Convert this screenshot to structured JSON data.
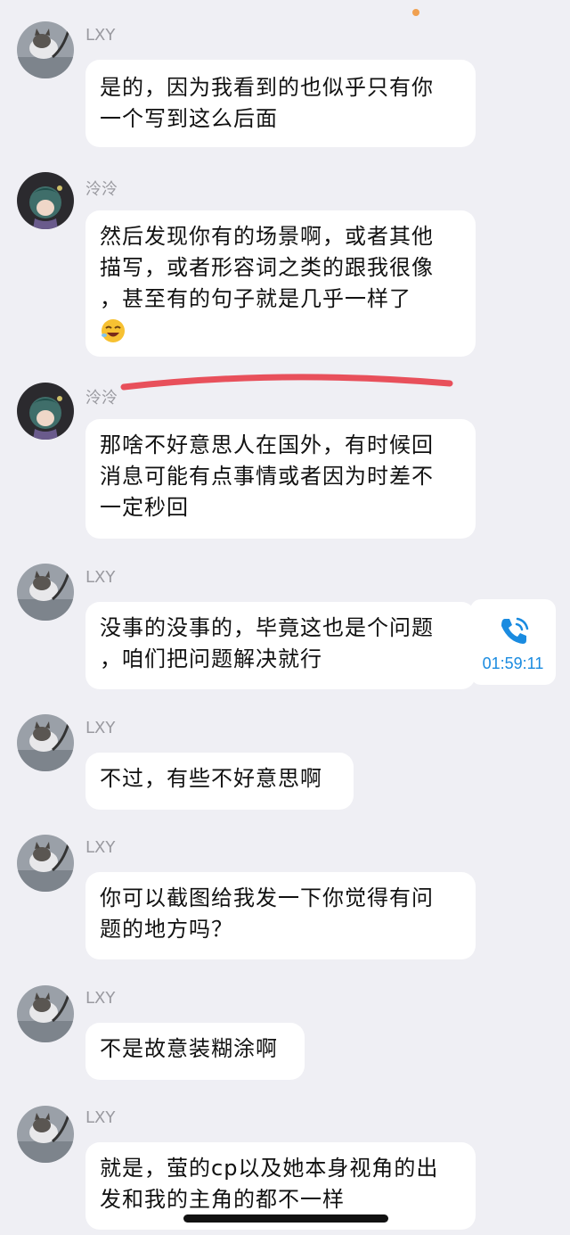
{
  "messages": [
    {
      "sender": "LXY",
      "avatar": "cat-avatar",
      "text": "是的，因为我看到的也似乎只有你\n一个写到这么后面"
    },
    {
      "sender": "泠泠",
      "avatar": "anime-avatar",
      "text": "然后发现你有的场景啊，或者其他\n描写，或者形容词之类的跟我很像\n，甚至有的句子就是几乎一样了",
      "emoji": "laughing-face-emoji"
    },
    {
      "sender": "泠泠",
      "avatar": "anime-avatar",
      "text": "那啥不好意思人在国外，有时候回\n消息可能有点事情或者因为时差不\n一定秒回"
    },
    {
      "sender": "LXY",
      "avatar": "cat-avatar",
      "text": "没事的没事的，毕竟这也是个问题\n，咱们把问题解决就行"
    },
    {
      "sender": "LXY",
      "avatar": "cat-avatar",
      "text": "不过，有些不好意思啊"
    },
    {
      "sender": "LXY",
      "avatar": "cat-avatar",
      "text": "你可以截图给我发一下你觉得有问\n题的地方吗？"
    },
    {
      "sender": "LXY",
      "avatar": "cat-avatar",
      "text": "不是故意装糊涂啊"
    },
    {
      "sender": "LXY",
      "avatar": "cat-avatar",
      "text": "就是，萤的cp以及她本身视角的出\n发和我的主角的都不一样"
    }
  ],
  "call": {
    "icon": "phone-icon",
    "duration": "01:59:11",
    "color": "#1a8be0"
  },
  "annotation": {
    "color": "#e8505b",
    "shape": "red-underline"
  },
  "theme": {
    "background": "#efeff4",
    "bubble": "#ffffff",
    "sender_color": "#9a9aa0"
  }
}
